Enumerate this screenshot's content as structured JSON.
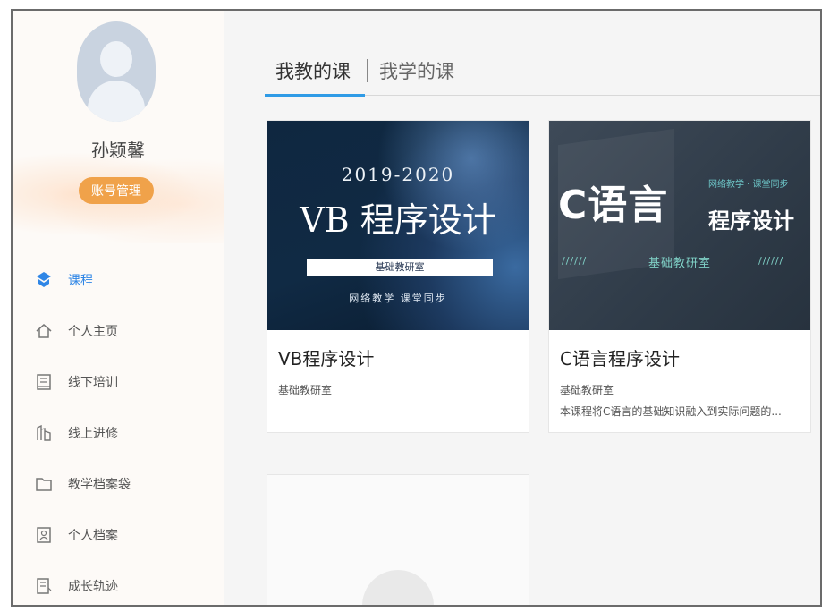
{
  "sidebar": {
    "username": "孙颖馨",
    "account_button": "账号管理",
    "nav": [
      {
        "label": "课程",
        "icon": "course-icon",
        "active": true
      },
      {
        "label": "个人主页",
        "icon": "home-icon"
      },
      {
        "label": "线下培训",
        "icon": "offline-training-icon"
      },
      {
        "label": "线上进修",
        "icon": "online-study-icon"
      },
      {
        "label": "教学档案袋",
        "icon": "folder-icon"
      },
      {
        "label": "个人档案",
        "icon": "profile-icon"
      },
      {
        "label": "成长轨迹",
        "icon": "growth-track-icon"
      }
    ]
  },
  "main": {
    "tabs": {
      "teach": "我教的课",
      "learn": "我学的课"
    },
    "courses": [
      {
        "title": "VB程序设计",
        "group": "基础教研室",
        "cover": {
          "year": "2019-2020",
          "title": "VB 程序设计",
          "bar": "基础教研室",
          "tags": "网络教学 课堂同步"
        }
      },
      {
        "title": "C语言程序设计",
        "group": "基础教研室",
        "desc": "本课程将C语言的基础知识融入到实际问题的...",
        "cover": {
          "title": "C语言",
          "tag": "网络教学 · 课堂同步",
          "subtitle": "程序设计",
          "lab": "基础教研室",
          "dashes": "//////"
        }
      }
    ]
  },
  "colors": {
    "accent": "#2f9be6",
    "account_button": "#f0a24a"
  }
}
